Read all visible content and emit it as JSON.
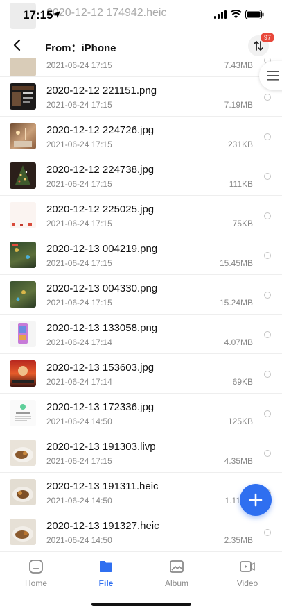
{
  "status_bar": {
    "time": "17:15"
  },
  "header_ghost": {
    "name": "2020-12-12 174942.heic"
  },
  "nav": {
    "title": "From：iPhone",
    "badge_count": "97"
  },
  "files": [
    {
      "name": "",
      "date": "2021-06-24 17:15",
      "size": "7.43MB",
      "thumb": "beige"
    },
    {
      "name": "2020-12-12 221151.png",
      "date": "2021-06-24 17:15",
      "size": "7.19MB",
      "thumb": "dark"
    },
    {
      "name": "2020-12-12 224726.jpg",
      "date": "2021-06-24 17:15",
      "size": "231KB",
      "thumb": "warm"
    },
    {
      "name": "2020-12-12 224738.jpg",
      "date": "2021-06-24 17:15",
      "size": "111KB",
      "thumb": "tree"
    },
    {
      "name": "2020-12-12 225025.jpg",
      "date": "2021-06-24 17:15",
      "size": "75KB",
      "thumb": "white"
    },
    {
      "name": "2020-12-13 004219.png",
      "date": "2021-06-24 17:15",
      "size": "15.45MB",
      "thumb": "game"
    },
    {
      "name": "2020-12-13 004330.png",
      "date": "2021-06-24 17:15",
      "size": "15.24MB",
      "thumb": "game2"
    },
    {
      "name": "2020-12-13 133058.png",
      "date": "2021-06-24 17:14",
      "size": "4.07MB",
      "thumb": "phone"
    },
    {
      "name": "2020-12-13 153603.jpg",
      "date": "2021-06-24 17:14",
      "size": "69KB",
      "thumb": "poster"
    },
    {
      "name": "2020-12-13 172336.jpg",
      "date": "2021-06-24 14:50",
      "size": "125KB",
      "thumb": "doc"
    },
    {
      "name": "2020-12-13 191303.livp",
      "date": "2021-06-24 17:15",
      "size": "4.35MB",
      "thumb": "food"
    },
    {
      "name": "2020-12-13 191311.heic",
      "date": "2021-06-24 14:50",
      "size": "1.11MB",
      "thumb": "food"
    },
    {
      "name": "2020-12-13 191327.heic",
      "date": "2021-06-24 14:50",
      "size": "2.35MB",
      "thumb": "food"
    }
  ],
  "tabs": [
    {
      "label": "Home",
      "icon": "home-icon"
    },
    {
      "label": "File",
      "icon": "folder-icon"
    },
    {
      "label": "Album",
      "icon": "image-icon"
    },
    {
      "label": "Video",
      "icon": "video-icon"
    }
  ],
  "colors": {
    "accent": "#2f6ff0",
    "badge": "#e8483b"
  }
}
